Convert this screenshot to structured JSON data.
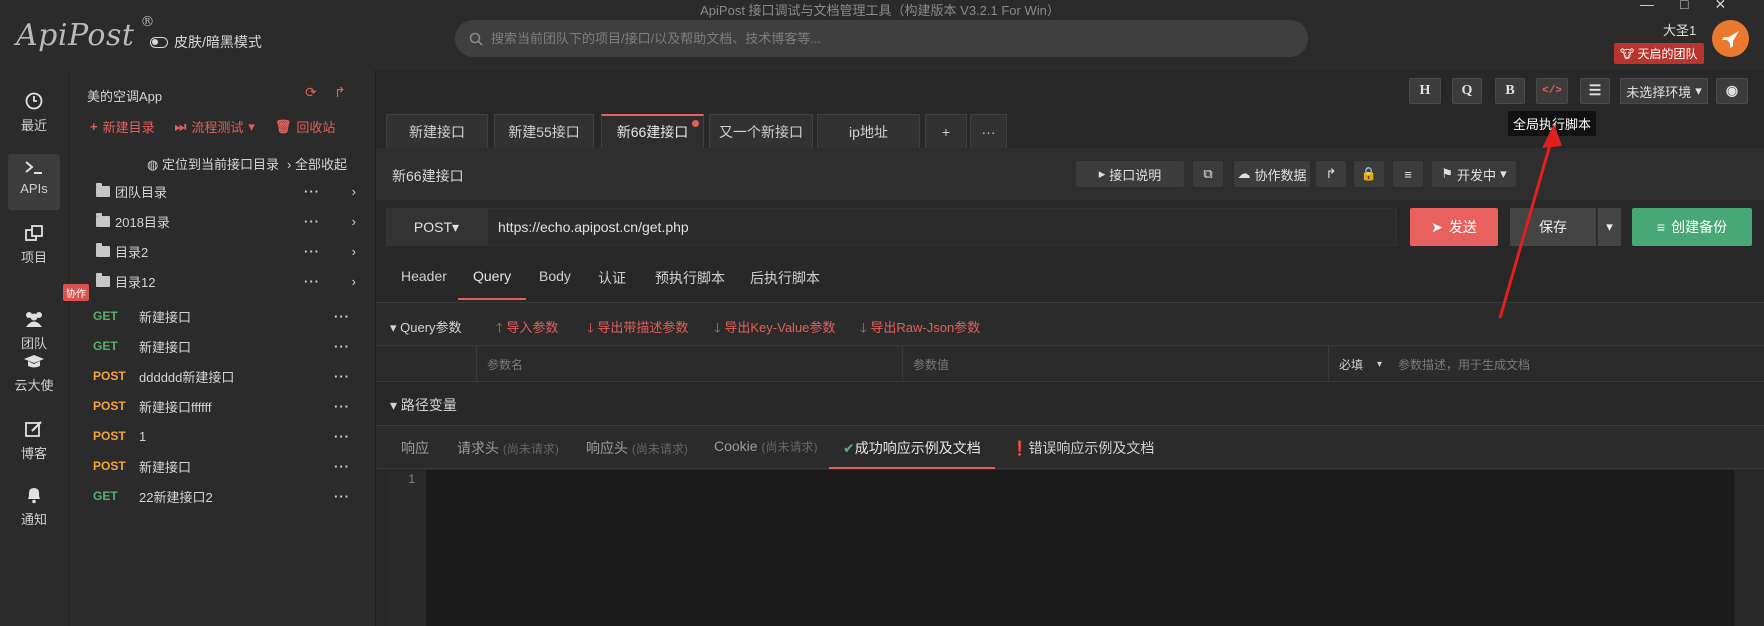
{
  "app": {
    "logo": "ApiPost",
    "logo_mark": "®",
    "skin_mode": "皮肤/暗黑模式",
    "window_title": "ApiPost 接口调试与文档管理工具（构建版本 V3.2.1 For Win）",
    "search_placeholder": "搜索当前团队下的项目/接口/以及帮助文档、技术博客等...",
    "username": "大圣1",
    "team": "天启的团队",
    "win_controls": [
      "—",
      "□",
      "✕"
    ]
  },
  "nav": [
    {
      "label": "最近",
      "icon": "clock-icon"
    },
    {
      "label": "APIs",
      "icon": "terminal-icon"
    },
    {
      "label": "项目",
      "icon": "project-icon"
    },
    {
      "label": "团队",
      "icon": "team-icon",
      "badge": "协作"
    },
    {
      "label": "云大使",
      "icon": "graduation-cap-icon"
    },
    {
      "label": "博客",
      "icon": "edit-icon"
    },
    {
      "label": "通知",
      "icon": "bell-icon"
    }
  ],
  "tree": {
    "project": "美的空调App",
    "actions": {
      "new_dir": "新建目录",
      "flow_test": "流程测试",
      "recycle": "回收站"
    },
    "locate": "定位到当前接口目录",
    "collapse": "全部收起",
    "folders": [
      "团队目录",
      "2018目录",
      "目录2",
      "目录12"
    ],
    "apis": [
      {
        "method": "GET",
        "name": "新建接口"
      },
      {
        "method": "GET",
        "name": "新建接口"
      },
      {
        "method": "POST",
        "name": "dddddd新建接口"
      },
      {
        "method": "POST",
        "name": "新建接口ffffff"
      },
      {
        "method": "POST",
        "name": "1"
      },
      {
        "method": "POST",
        "name": "新建接口"
      },
      {
        "method": "GET",
        "name": "22新建接口2"
      }
    ]
  },
  "toolbar": {
    "h": "H",
    "q": "Q",
    "b": "B",
    "code": "</>",
    "env": "未选择环境",
    "tooltip": "全局执行脚本"
  },
  "tabs": [
    "新建接口",
    "新建55接口",
    "新66建接口",
    "又一个新接口",
    "ip地址",
    "+",
    "···"
  ],
  "request": {
    "name": "新66建接口",
    "doc_btn": "接口说明",
    "collab": "协作数据",
    "env_status": "开发中",
    "method": "POST",
    "url": "https://echo.apipost.cn/get.php",
    "send": "发送",
    "save": "保存",
    "backup": "创建备份"
  },
  "subtabs": [
    "Header",
    "Query",
    "Body",
    "认证",
    "预执行脚本",
    "后执行脚本"
  ],
  "query": {
    "title": "Query参数",
    "import": "导入参数",
    "export_desc": "导出带描述参数",
    "export_kv": "导出Key-Value参数",
    "export_raw": "导出Raw-Json参数",
    "col_name": "参数名",
    "col_value": "参数值",
    "required": "必填",
    "desc_placeholder": "参数描述，用于生成文档"
  },
  "path_vars": "路径变量",
  "response_tabs": {
    "resp": "响应",
    "req_head": "请求头",
    "resp_head": "响应头",
    "cookie": "Cookie",
    "pending": "(尚未请求)",
    "success_doc": "成功响应示例及文档",
    "error_doc": "错误响应示例及文档"
  },
  "editor": {
    "line1": "1"
  },
  "colors": {
    "accent": "#e0605a",
    "get": "#54b268",
    "post": "#f2a53a",
    "send": "#e8615e",
    "backup": "#47a776"
  }
}
